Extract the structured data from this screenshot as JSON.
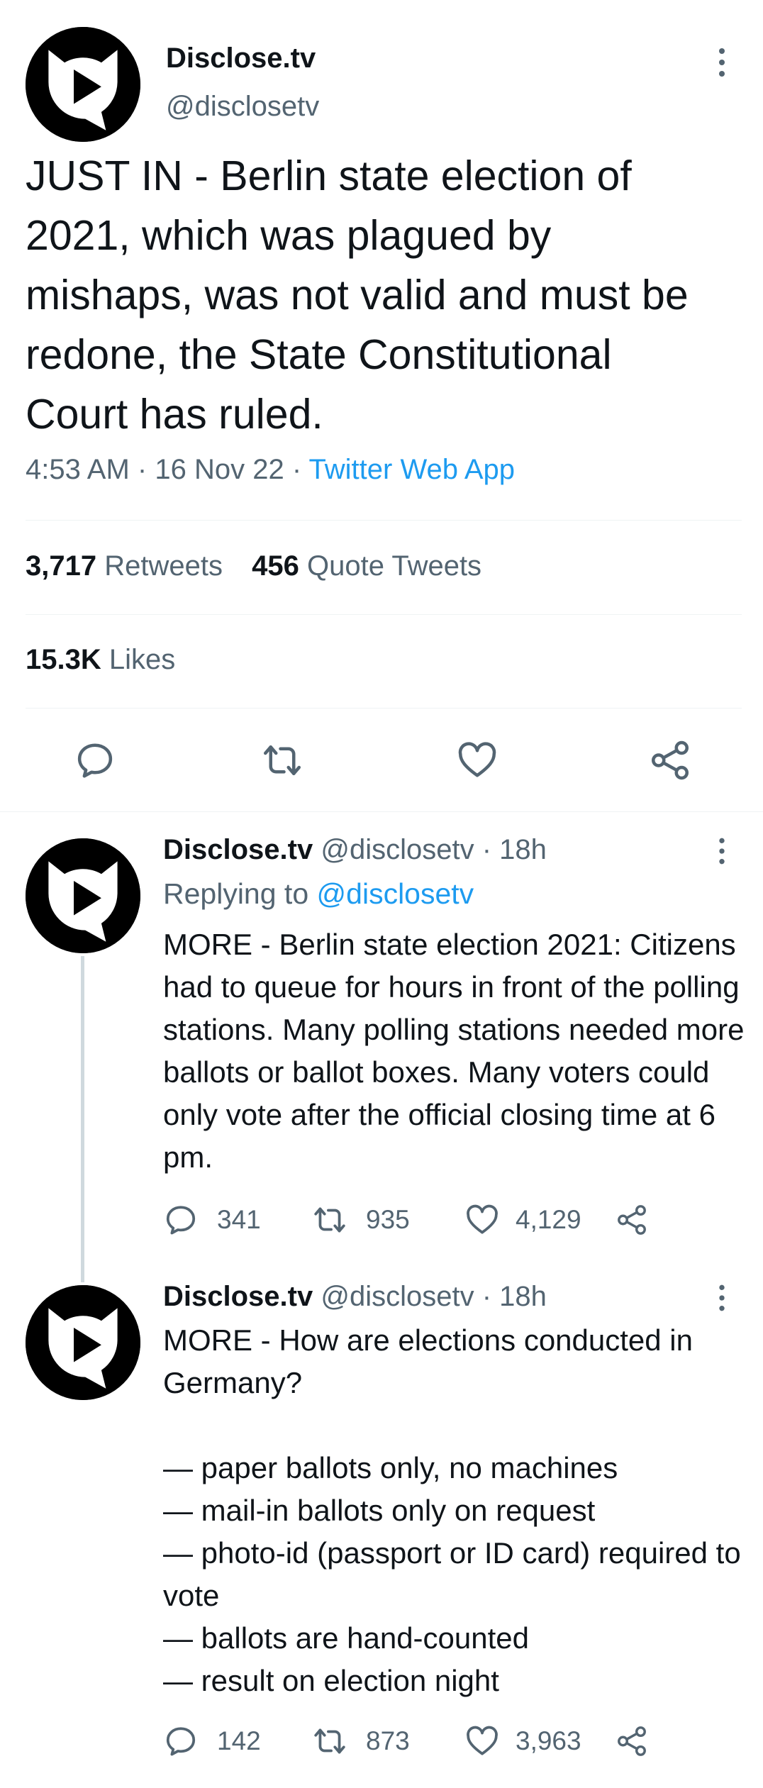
{
  "main_tweet": {
    "display_name": "Disclose.tv",
    "handle": "@disclosetv",
    "text": "JUST IN - Berlin state election of 2021, which was plagued by mishaps, was not valid and must be redone, the State Constitutional Court has ruled.",
    "time": "4:53 AM",
    "date": "16 Nov 22",
    "separator": "·",
    "source": "Twitter Web App",
    "retweets_count": "3,717",
    "retweets_label": "Retweets",
    "quotes_count": "456",
    "quotes_label": "Quote Tweets",
    "likes_count": "15.3K",
    "likes_label": "Likes"
  },
  "replies": [
    {
      "display_name": "Disclose.tv",
      "handle": "@disclosetv",
      "time": "· 18h",
      "replying_label": "Replying to",
      "replying_to": "@disclosetv",
      "text": "MORE - Berlin state election 2021: Citizens had to queue for hours in front of the polling stations. Many polling stations needed more ballots or ballot boxes. Many voters could only vote after the official closing time at 6 pm.",
      "reply_count": "341",
      "retweet_count": "935",
      "like_count": "4,129"
    },
    {
      "display_name": "Disclose.tv",
      "handle": "@disclosetv",
      "time": "· 18h",
      "text": "MORE - How are elections conducted in Germany?\n\n— paper ballots only, no machines\n— mail-in ballots only on request\n— photo-id (passport or ID card) required to vote\n— ballots are hand-counted\n— result on election night",
      "reply_count": "142",
      "retweet_count": "873",
      "like_count": "3,963"
    }
  ],
  "icons": {
    "avatar": "disclose-tv-logo",
    "more": "more-vertical-icon",
    "reply": "reply-icon",
    "retweet": "retweet-icon",
    "like": "like-icon",
    "share": "share-icon"
  },
  "colors": {
    "link": "#1d9bf0",
    "secondary": "#536471",
    "text": "#0f1419",
    "divider": "#eff3f4"
  }
}
